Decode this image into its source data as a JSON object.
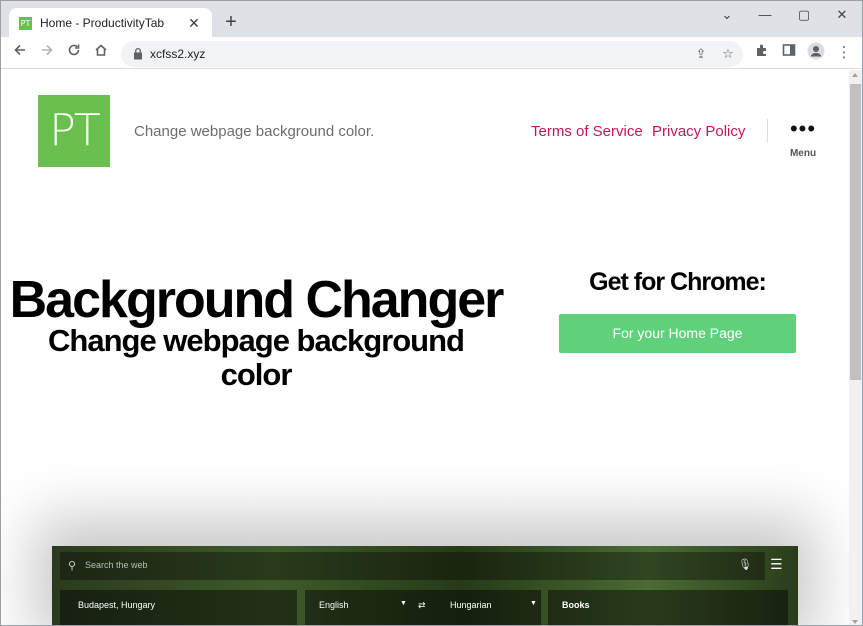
{
  "browser": {
    "tab_title": "Home - ProductivityTab",
    "favicon_text": "PT",
    "close_glyph": "✕",
    "new_tab_glyph": "+",
    "url": "xcfss2.xyz",
    "controls": {
      "minimize": "—",
      "maximize": "▢",
      "close": "✕",
      "dropdown": "⌄"
    }
  },
  "header": {
    "logo_text": "PT",
    "tagline": "Change webpage background color.",
    "nav": [
      {
        "label": "Terms of Service"
      },
      {
        "label": "Privacy Policy"
      }
    ],
    "menu_dots": "•••",
    "menu_label": "Menu"
  },
  "hero": {
    "title": "Background Changer",
    "subtitle": "Change webpage background color"
  },
  "cta": {
    "heading": "Get for Chrome:",
    "button_label": "For your Home Page",
    "button_color": "#5fd17a"
  },
  "preview": {
    "search_placeholder": "Search the web",
    "location": "Budapest, Hungary",
    "lang_from": "English",
    "lang_to": "Hungarian",
    "books_label": "Books"
  },
  "colors": {
    "brand_green": "#6bbf4e",
    "link": "#c2185b"
  }
}
